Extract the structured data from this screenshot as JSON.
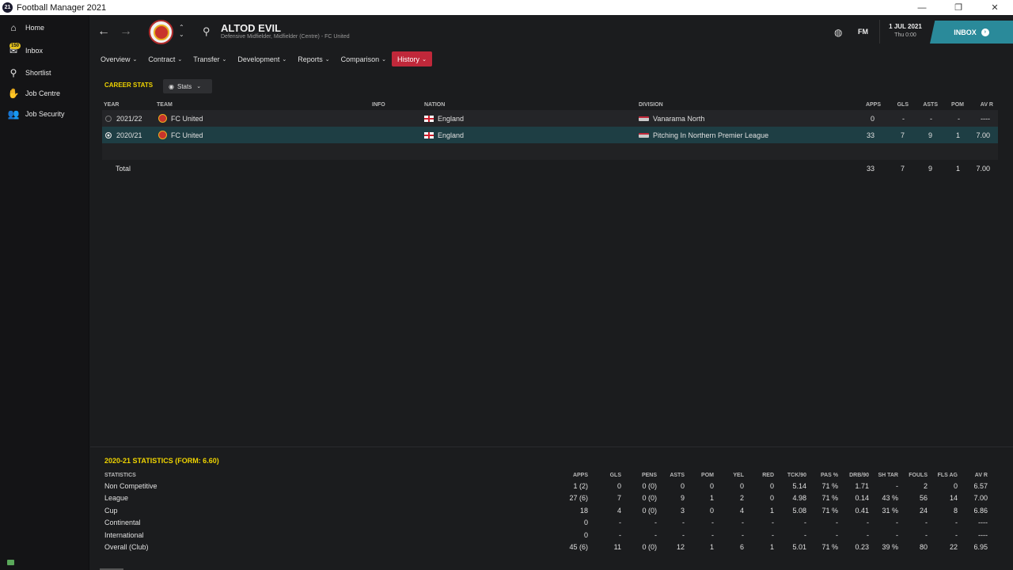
{
  "window": {
    "title": "Football Manager 2021",
    "app_icon_text": "21",
    "minimize": "—",
    "maximize": "❐",
    "close": "✕"
  },
  "sidebar": {
    "items": [
      {
        "label": "Home",
        "icon": "home-icon"
      },
      {
        "label": "Inbox",
        "icon": "inbox-icon",
        "badge": "150"
      },
      {
        "label": "Shortlist",
        "icon": "search-icon"
      },
      {
        "label": "Job Centre",
        "icon": "handshake-icon"
      },
      {
        "label": "Job Security",
        "icon": "people-icon"
      }
    ]
  },
  "header": {
    "player_name": "ALTOD EVIL",
    "player_sub": "Defensive Midfielder, Midfielder (Centre) - FC United",
    "fm_logo": "FM",
    "date": "1 JUL 2021",
    "time": "Thu 0:00",
    "inbox_label": "INBOX"
  },
  "menu": {
    "items": [
      {
        "label": "Overview",
        "active": false
      },
      {
        "label": "Contract",
        "active": false
      },
      {
        "label": "Transfer",
        "active": false
      },
      {
        "label": "Development",
        "active": false
      },
      {
        "label": "Reports",
        "active": false
      },
      {
        "label": "Comparison",
        "active": false
      },
      {
        "label": "History",
        "active": true
      }
    ]
  },
  "career": {
    "title": "CAREER STATS",
    "view_label": "Stats",
    "columns": {
      "year": "YEAR",
      "team": "TEAM",
      "info": "INFO",
      "nation": "NATION",
      "division": "DIVISION",
      "apps": "APPS",
      "gls": "GLS",
      "asts": "ASTS",
      "pom": "POM",
      "avr": "AV R"
    },
    "rows": [
      {
        "year": "2021/22",
        "team": "FC United",
        "nation": "England",
        "division": "Vanarama North",
        "apps": "0",
        "gls": "-",
        "asts": "-",
        "pom": "-",
        "avr": "----",
        "selected": false
      },
      {
        "year": "2020/21",
        "team": "FC United",
        "nation": "England",
        "division": "Pitching In Northern Premier League",
        "apps": "33",
        "gls": "7",
        "asts": "9",
        "pom": "1",
        "avr": "7.00",
        "selected": true
      }
    ],
    "total": {
      "label": "Total",
      "apps": "33",
      "gls": "7",
      "asts": "9",
      "pom": "1",
      "avr": "7.00"
    }
  },
  "season": {
    "title": "2020-21 STATISTICS (FORM: 6.60)",
    "columns": [
      "STATISTICS",
      "APPS",
      "GLS",
      "PENS",
      "ASTS",
      "POM",
      "YEL",
      "RED",
      "TCK/90",
      "PAS %",
      "DRB/90",
      "SH TAR",
      "FOULS",
      "FLS AG",
      "AV R"
    ],
    "rows": [
      [
        "Non Competitive",
        "1 (2)",
        "0",
        "0 (0)",
        "0",
        "0",
        "0",
        "0",
        "5.14",
        "71 %",
        "1.71",
        "-",
        "2",
        "0",
        "6.57"
      ],
      [
        "League",
        "27 (6)",
        "7",
        "0 (0)",
        "9",
        "1",
        "2",
        "0",
        "4.98",
        "71 %",
        "0.14",
        "43 %",
        "56",
        "14",
        "7.00"
      ],
      [
        "Cup",
        "18",
        "4",
        "0 (0)",
        "3",
        "0",
        "4",
        "1",
        "5.08",
        "71 %",
        "0.41",
        "31 %",
        "24",
        "8",
        "6.86"
      ],
      [
        "Continental",
        "0",
        "-",
        "-",
        "-",
        "-",
        "-",
        "-",
        "-",
        "-",
        "-",
        "-",
        "-",
        "-",
        "----"
      ],
      [
        "International",
        "0",
        "-",
        "-",
        "-",
        "-",
        "-",
        "-",
        "-",
        "-",
        "-",
        "-",
        "-",
        "-",
        "----"
      ],
      [
        "Overall (Club)",
        "45 (6)",
        "11",
        "0 (0)",
        "12",
        "1",
        "6",
        "1",
        "5.01",
        "71 %",
        "0.23",
        "39 %",
        "80",
        "22",
        "6.95"
      ]
    ]
  },
  "colors": {
    "accent": "#c0283a",
    "highlight": "#f0d400",
    "inbox": "#2a8a9a",
    "selected_row": "#1e3e44"
  }
}
